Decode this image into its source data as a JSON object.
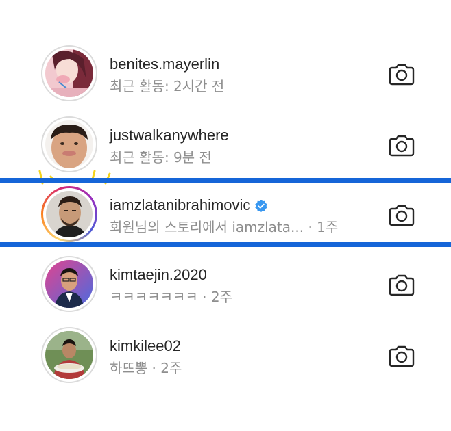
{
  "rows": [
    {
      "username": "benites.mayerlin",
      "sub": "최근 활동: 2시간 전",
      "verified": false,
      "story": false
    },
    {
      "username": "justwalkanywhere",
      "sub": "최근 활동: 9분 전",
      "verified": false,
      "story": false
    },
    {
      "username": "iamzlatanibrahimovic",
      "sub": "회원님의 스토리에서 iamzlata... · 1주",
      "verified": true,
      "story": true
    },
    {
      "username": "kimtaejin.2020",
      "sub": "ㅋㅋㅋㅋㅋㅋㅋ · 2주",
      "verified": false,
      "story": false
    },
    {
      "username": "kimkilee02",
      "sub": "하뜨뽕 · 2주",
      "verified": false,
      "story": false
    }
  ],
  "icons": {
    "action": "camera-icon",
    "verified": "verified-badge-icon"
  },
  "colors": {
    "highlight": "#1565d8",
    "verified": "#3897f0",
    "secondary_text": "#8e8e8e",
    "primary_text": "#262626",
    "spark": "#f4d31c"
  }
}
